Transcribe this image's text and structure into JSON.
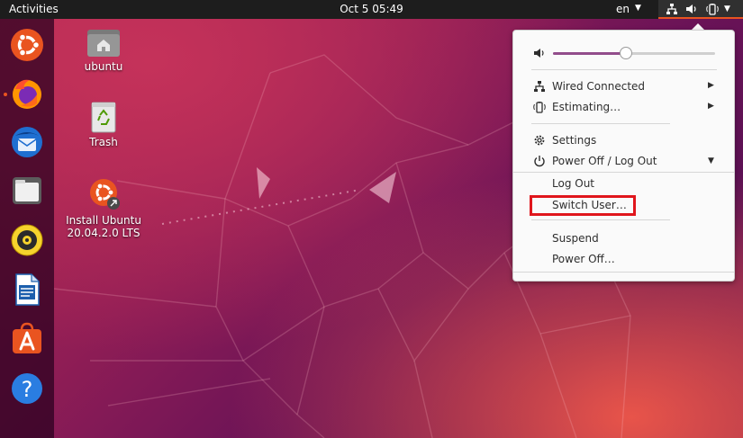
{
  "topbar": {
    "activities": "Activities",
    "clock": "Oct 5  05:49",
    "language": "en"
  },
  "desktop": {
    "icons": [
      {
        "label": "ubuntu",
        "icon": "home-folder-icon"
      },
      {
        "label": "Trash",
        "icon": "trash-icon"
      },
      {
        "label_line1": "Install Ubuntu",
        "label_line2": "20.04.2.0 LTS",
        "icon": "ubuntu-installer-icon"
      }
    ]
  },
  "dock": {
    "items": [
      "ubuntu-icon",
      "firefox-icon",
      "thunderbird-icon",
      "files-icon",
      "rhythmbox-icon",
      "libreoffice-writer-icon",
      "software-center-icon",
      "help-icon"
    ]
  },
  "system_menu": {
    "volume_level": 0.45,
    "wired": "Wired Connected",
    "battery": "Estimating…",
    "settings": "Settings",
    "power_off_log_out": "Power Off / Log Out",
    "log_out": "Log Out",
    "switch_user": "Switch User…",
    "suspend": "Suspend",
    "power_off": "Power Off…"
  },
  "colors": {
    "accent": "#e95420",
    "highlight": "#e0161c",
    "slider": "#924d8b"
  }
}
